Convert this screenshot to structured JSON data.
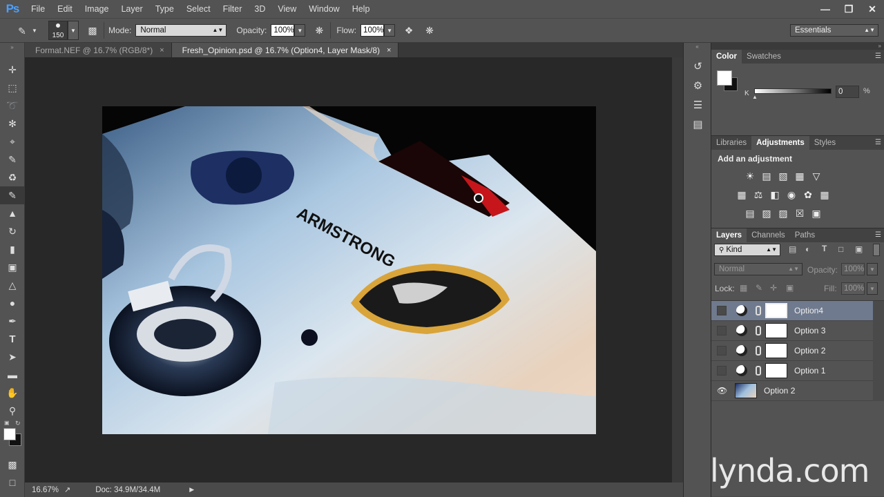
{
  "app": {
    "logo": "Ps"
  },
  "menu": [
    "File",
    "Edit",
    "Image",
    "Layer",
    "Type",
    "Select",
    "Filter",
    "3D",
    "View",
    "Window",
    "Help"
  ],
  "options": {
    "brush_size": "150",
    "mode_label": "Mode:",
    "mode_value": "Normal",
    "opacity_label": "Opacity:",
    "opacity_value": "100%",
    "flow_label": "Flow:",
    "flow_value": "100%",
    "workspace": "Essentials"
  },
  "tabs": [
    {
      "label": "Format.NEF @ 16.7% (RGB/8*)",
      "close": "×"
    },
    {
      "label": "Fresh_Opinion.psd @ 16.7% (Option4, Layer Mask/8)",
      "close": "×"
    }
  ],
  "photo_text": "ARMSTRONG",
  "status": {
    "zoom": "16.67%",
    "doc": "Doc: 34.9M/34.4M"
  },
  "color_panel": {
    "tabs": [
      "Color",
      "Swatches"
    ],
    "channel_label": "K",
    "channel_value": "0",
    "unit": "%"
  },
  "adjust_panel": {
    "tabs": [
      "Libraries",
      "Adjustments",
      "Styles"
    ],
    "heading": "Add an adjustment"
  },
  "layers_panel": {
    "tabs": [
      "Layers",
      "Channels",
      "Paths"
    ],
    "filter": "Kind",
    "blend_mode": "Normal",
    "opacity_label": "Opacity:",
    "opacity_value": "100%",
    "lock_label": "Lock:",
    "fill_label": "Fill:",
    "fill_value": "100%",
    "layers": [
      {
        "name": "Option4",
        "selected": true
      },
      {
        "name": "Option 3",
        "selected": false
      },
      {
        "name": "Option 2",
        "selected": false
      },
      {
        "name": "Option 1",
        "selected": false
      },
      {
        "name": "Option 2",
        "selected": false
      }
    ]
  },
  "watermark": "lynda.com",
  "colors": {
    "accent": "#4aa0ff",
    "selected_layer": "#6f7a8e"
  }
}
